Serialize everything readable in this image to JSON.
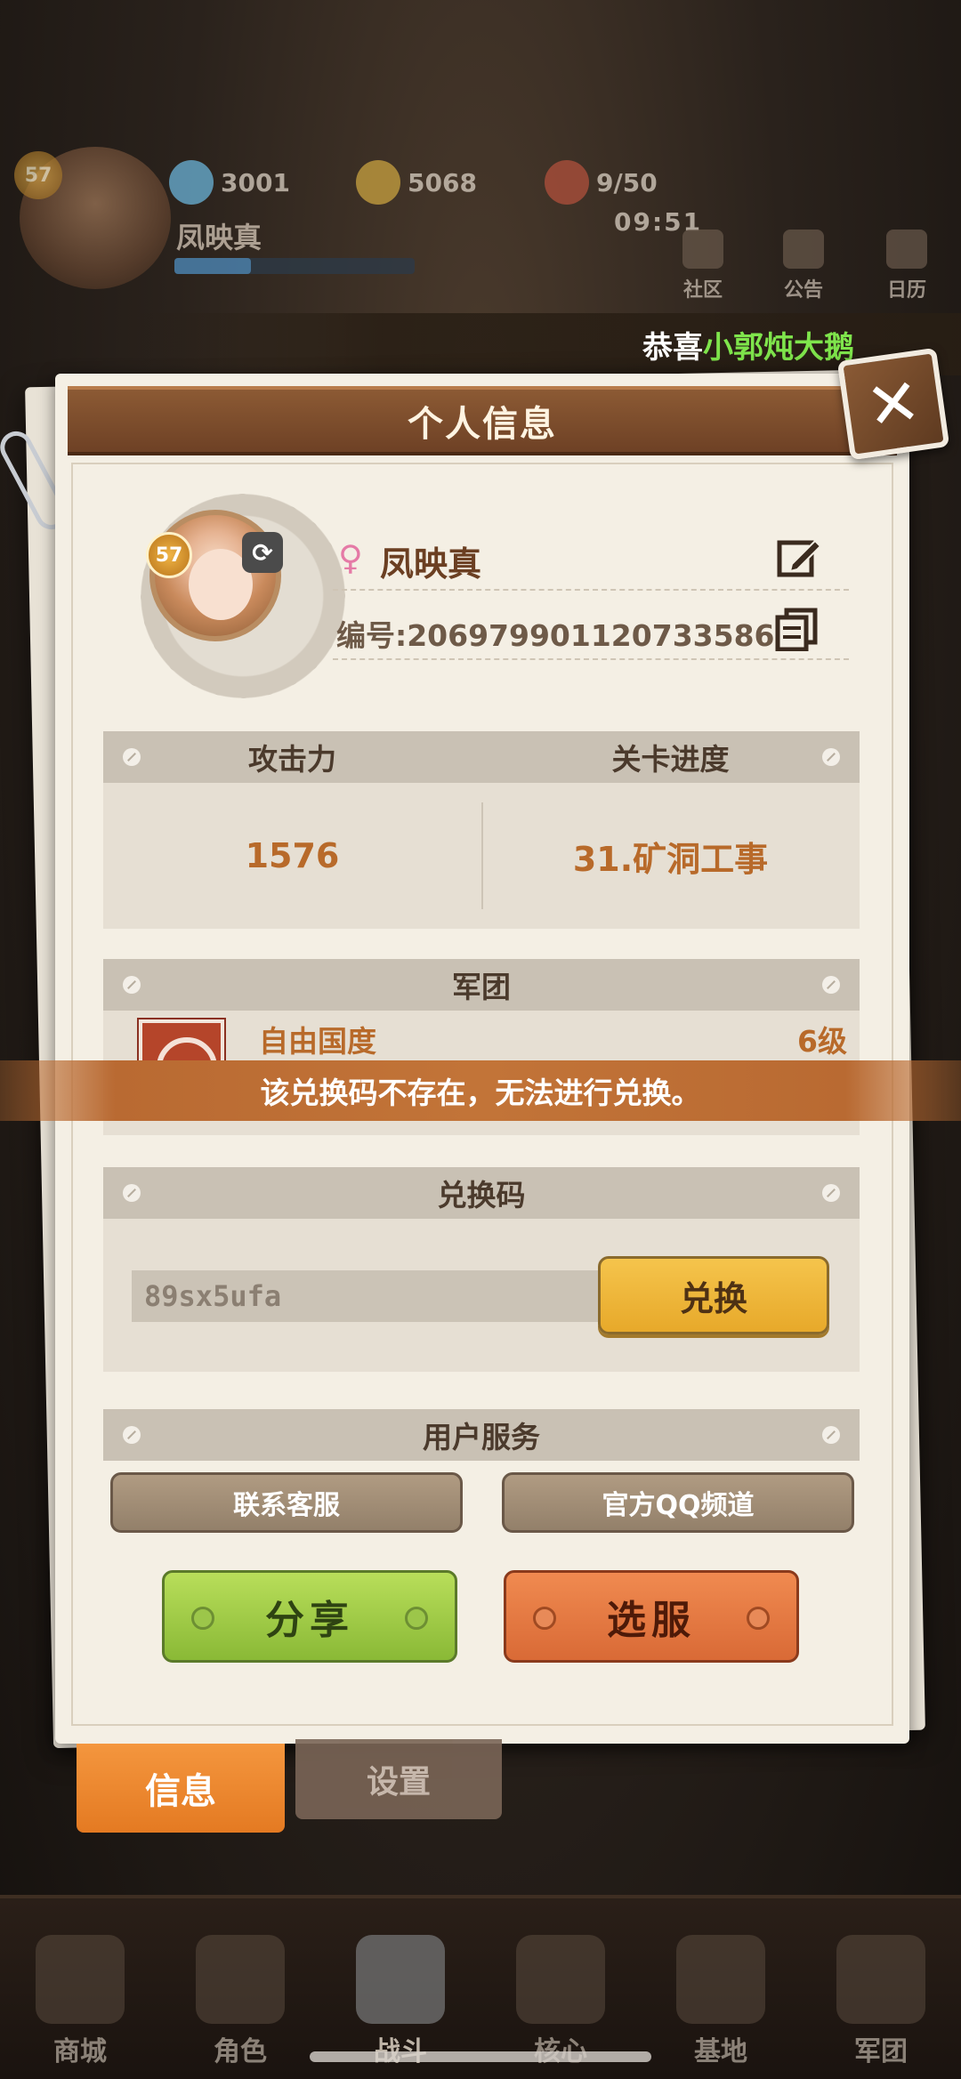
{
  "background": {
    "top_hud": {
      "level": "57",
      "player_name": "凤映真",
      "resources": [
        {
          "icon": "diamond-icon",
          "value": "3001"
        },
        {
          "icon": "coin-icon",
          "value": "5068"
        },
        {
          "icon": "meat-icon",
          "value": "9/50"
        }
      ],
      "timer": "09:51",
      "shortcuts": [
        {
          "icon": "community-icon",
          "label": "社区"
        },
        {
          "icon": "announcement-icon",
          "label": "公告"
        },
        {
          "icon": "calendar-icon",
          "label": "日历"
        }
      ]
    },
    "ticker": {
      "prefix": "恭喜",
      "highlight": "小郭炖大鹅"
    },
    "bottom_nav": [
      {
        "icon": "shop-icon",
        "label": "商城"
      },
      {
        "icon": "character-icon",
        "label": "角色"
      },
      {
        "icon": "battle-icon",
        "label": "战斗"
      },
      {
        "icon": "core-icon",
        "label": "核心"
      },
      {
        "icon": "base-icon",
        "label": "基地"
      },
      {
        "icon": "legion-icon",
        "label": "军团"
      }
    ]
  },
  "modal": {
    "title": "个人信息",
    "profile": {
      "level": "57",
      "name": "凤映真",
      "gender_icon": "female-icon",
      "id_text": "编号:2069799011207335866"
    },
    "stats": {
      "attack_label": "攻击力",
      "attack_value": "1576",
      "progress_label": "关卡进度",
      "progress_value": "31.矿洞工事"
    },
    "guild": {
      "header": "军团",
      "name": "自由国度",
      "level": "6级"
    },
    "redeem": {
      "header": "兑换码",
      "code_value": "89sx5ufa",
      "button": "兑换"
    },
    "service": {
      "header": "用户服务",
      "contact": "联系客服",
      "qq_channel": "官方QQ频道"
    },
    "share_button": "分享",
    "server_button": "选服"
  },
  "tabs": {
    "info": "信息",
    "settings": "设置"
  },
  "toast": "该兑换码不存在，无法进行兑换。",
  "colors": {
    "accent_orange": "#e47a22",
    "header_brown": "#6e4125",
    "value_orange": "#b86a2a",
    "share_green": "#8ab936",
    "server_orange": "#d96a36",
    "redeem_yellow": "#e7a92a"
  }
}
